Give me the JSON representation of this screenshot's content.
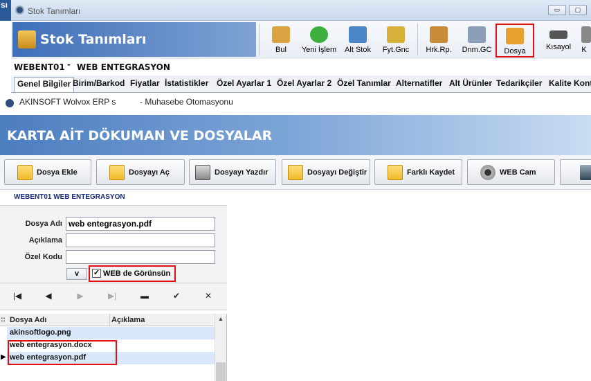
{
  "left_stub_text": "sı",
  "window": {
    "title": "Stok Tanımları",
    "minimize": "▭",
    "maximize": "▢",
    "close": "✕"
  },
  "banner": {
    "title": "Stok Tanımları"
  },
  "toolbar": [
    {
      "label": "Bul",
      "color": "#d9a441"
    },
    {
      "label": "Yeni İşlem",
      "color": "#3dae3d"
    },
    {
      "label": "Alt Stok",
      "color": "#4a86c8"
    },
    {
      "label": "Fyt.Gnc",
      "color": "#d6b23a"
    },
    {
      "label": "Hrk.Rp.",
      "color": "#c88b3a"
    },
    {
      "label": "Dnm.GC",
      "color": "#8ba0b8"
    },
    {
      "label": "Dosya",
      "color": "#e8a030"
    },
    {
      "label": "Kısayol",
      "color": "#555555"
    },
    {
      "label": "K",
      "color": "#888888"
    }
  ],
  "stock_code": "WEBENT01",
  "stock_dash": "-",
  "stock_name": "WEB ENTEGRASYON",
  "tabs": [
    "Genel Bilgiler",
    "Birim/Barkod",
    "Fiyatlar",
    "İstatistikler",
    "Özel Ayarlar 1",
    "Özel Ayarlar 2",
    "Özel Tanımlar",
    "Alternatifler",
    "Alt Ürünler",
    "Tedarikçiler",
    "Kalite Kont"
  ],
  "info": {
    "app": "AKINSOFT Wolvox ERP s",
    "module": "- Muhasebe Otomasyonu"
  },
  "section_title": "KARTA AİT DÖKUMAN VE DOSYALAR",
  "actions": [
    "Dosya Ekle",
    "Dosyayı Aç",
    "Dosyayı Yazdır",
    "Dosyayı Değiştir",
    "Farklı Kaydet",
    "WEB Cam"
  ],
  "subtitle": "WEBENT01 WEB ENTEGRASYON",
  "form": {
    "file_name_label": "Dosya Adı",
    "file_name_value": "web entegrasyon.pdf",
    "description_label": "Açıklama",
    "description_value": "",
    "special_code_label": "Özel Kodu",
    "special_code_value": "",
    "v_button": "v",
    "web_visible_label": "WEB de Görünsün",
    "web_visible_checked": true
  },
  "nav": {
    "first": "|◀",
    "prev": "◀",
    "next": "▶",
    "last": "▶|",
    "delete": "▬",
    "confirm": "✔",
    "cancel": "✕"
  },
  "grid": {
    "columns": [
      "Dosya Adı",
      "Açıklama"
    ],
    "rows": [
      {
        "name": "akinsoftlogo.png",
        "desc": ""
      },
      {
        "name": "web entegrasyon.docx",
        "desc": ""
      },
      {
        "name": "web entegrasyon.pdf",
        "desc": ""
      }
    ],
    "current_row": 2,
    "row_indicator": "▶",
    "corner": "::"
  },
  "colors": {
    "highlight_red": "#e01010",
    "banner_blue": "#3e6fb8",
    "row_blue": "#d8e8fa"
  }
}
